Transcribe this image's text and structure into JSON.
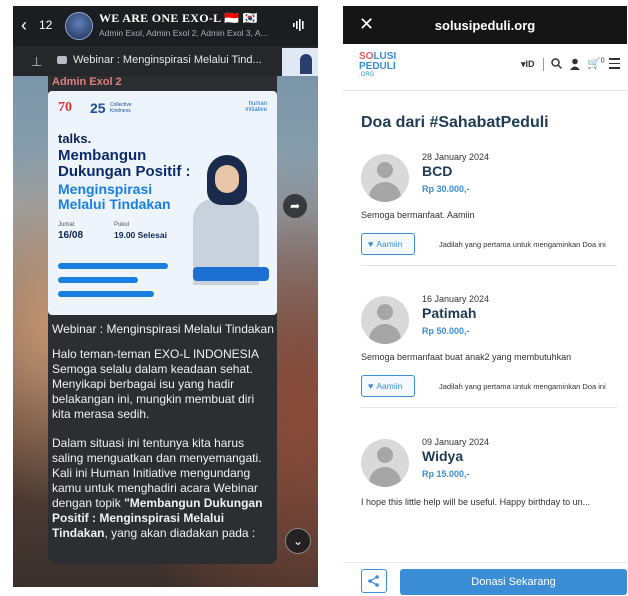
{
  "telegram": {
    "unread_count": "12",
    "group_title": "WE ARE ONE EXO-L 🇮🇩 🇰🇷",
    "group_title_text": "WE ARE ONE EXO-L",
    "members_preview": "Admin Exol, Admin Exol 2, Admin Exol 3, A...",
    "pinned_title": "Webinar : Menginspirasi Melalui Tind...",
    "message": {
      "sender": "Admin Exol 2",
      "poster": {
        "logo_70": "70",
        "logo_25": "25",
        "logo_25_caption": "Collective Kindness",
        "brand": "human initiative",
        "talks": "talks.",
        "headline_1": "Membangun Dukungan Positif :",
        "headline_2": "Menginspirasi Melalui Tindakan",
        "day_label": "Jumat",
        "date": "16/08",
        "time_label": "Pukul",
        "time": "19.00 Selesai"
      },
      "title": "Webinar : Menginspirasi Melalui Tindakan",
      "paragraph_1": "Halo teman-teman EXO-L INDONESIA Semoga selalu dalam keadaan sehat. Menyikapi berbagai isu yang hadir belakangan ini, mungkin membuat diri kita merasa sedih.",
      "paragraph_2_prefix": "Dalam situasi ini tentunya kita harus saling menguatkan dan menyemangati. Kali ini Human Initiative mengundang kamu untuk menghadiri acara Webinar dengan topik ",
      "paragraph_2_bold": "\"Membangun Dukungan Positif : Menginspirasi Melalui Tindakan",
      "paragraph_2_suffix": ", yang akan diadakan pada :"
    }
  },
  "browser": {
    "url": "solusipeduli.org",
    "logo": {
      "line1_a": "S",
      "line1_b": "LUSI",
      "line2": "PEDULI",
      "line3": ".ORG"
    },
    "language": "▾ID",
    "cart_count": "0",
    "heading": "Doa dari #SahabatPeduli",
    "amiin_label": "Aamiin",
    "first_aamiin_text": "Jadilah yang pertama untuk mengaminkan Doa ini",
    "doas": [
      {
        "date": "28 January 2024",
        "name": "BCD",
        "amount": "Rp 30.000,-",
        "message": "Semoga bermanfaat. Aamiin"
      },
      {
        "date": "16 January 2024",
        "name": "Patimah",
        "amount": "Rp 50.000,-",
        "message": "Semoga bermanfaat buat anak2 yang membutuhkan"
      },
      {
        "date": "09 January 2024",
        "name": "Widya",
        "amount": "Rp 15.000,-",
        "message": "I hope this little help will be useful. Happy birthday to un..."
      }
    ],
    "donate_label": "Donasi Sekarang"
  }
}
